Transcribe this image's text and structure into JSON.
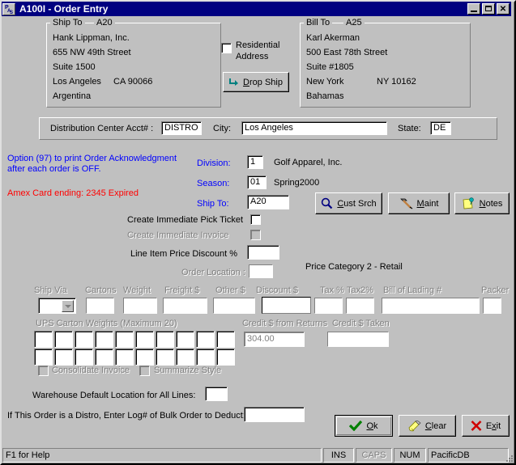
{
  "window": {
    "title": "A100I - Order Entry",
    "icon": "app-icon",
    "buttons": {
      "minimize": "minimize-icon",
      "maximize": "maximize-icon",
      "close": "close-icon"
    }
  },
  "ship_to": {
    "legend": "Ship To",
    "code": "A20",
    "lines": [
      "Hank Lippman, Inc.",
      "655 NW 49th Street",
      "Suite 1500",
      "Los Angeles          CA 90066",
      "Argentina"
    ],
    "city_state": {
      "city": "Los Angeles",
      "state_zip": "CA 90066"
    }
  },
  "bill_to": {
    "legend": "Bill To",
    "code": "A25",
    "lines": [
      "Karl Akerman",
      "500 East 78th Street",
      "Suite #1805",
      "New York             NY 10162",
      "Bahamas"
    ]
  },
  "residential": {
    "label_line1": "Residential",
    "label_line2": "Address",
    "checked": false
  },
  "drop_ship": {
    "label": "Drop Ship",
    "accesskey": "D",
    "icon": "drop-ship-arrow-icon"
  },
  "distribution": {
    "acct_label": "Distribution Center Acct# :",
    "acct_value": "DISTRO",
    "city_label": "City:",
    "city_value": "Los Angeles",
    "state_label": "State:",
    "state_value": "DE"
  },
  "messages": {
    "option_line1": "Option (97) to print Order Acknowledgment",
    "option_line2": "after each order is OFF.",
    "option_color": "#0000ff",
    "card_warning": "Amex  Card ending: 2345 Expired",
    "card_warning_color": "#ff0000"
  },
  "header_fields": {
    "division_label": "Division:",
    "division_value": "1",
    "division_name": "Golf Apparel, Inc.",
    "season_label": "Season:",
    "season_value": "01",
    "season_name": "Spring2000",
    "shipto_label": "Ship To:",
    "shipto_value": "A20"
  },
  "action_buttons": [
    {
      "name": "cust-srch-button",
      "label": "Cust Srch",
      "icon": "magnifier-icon",
      "accesskey": "C"
    },
    {
      "name": "maint-button",
      "label": "Maint",
      "icon": "hammer-icon",
      "accesskey": "M"
    },
    {
      "name": "notes-button",
      "label": "Notes",
      "icon": "notes-icon",
      "accesskey": "N"
    }
  ],
  "options": {
    "pick_ticket_label": "Create Immediate Pick Ticket",
    "pick_ticket_checked": false,
    "invoice_label": "Create Immediate Invoice",
    "invoice_checked": false,
    "invoice_disabled": true,
    "line_discount_label": "Line Item Price Discount %",
    "line_discount_value": "",
    "order_location_label": "Order Location :",
    "order_location_value": "",
    "order_location_disabled": true,
    "price_category": "Price Category 2 - Retail"
  },
  "shipping_grid": {
    "disabled": true,
    "columns": [
      {
        "header": "Ship Via",
        "value": "",
        "type": "combo"
      },
      {
        "header": "Cartons",
        "value": "",
        "type": "text"
      },
      {
        "header": "Weight",
        "value": "",
        "type": "text"
      },
      {
        "header": "Freight $",
        "value": "",
        "type": "text"
      },
      {
        "header": "Other $",
        "value": "",
        "type": "text"
      },
      {
        "header": "Discount $",
        "value": "",
        "type": "text"
      },
      {
        "header": "Tax %",
        "value": "",
        "type": "text"
      },
      {
        "header": "Tax2%",
        "value": "",
        "type": "text"
      },
      {
        "header": "Bill of Lading #",
        "value": "",
        "type": "text"
      },
      {
        "header": "Packer",
        "value": "",
        "type": "text"
      }
    ]
  },
  "carton_weights": {
    "label": "UPS Carton Weights  (Maximum 20)",
    "disabled": true,
    "count": 20,
    "values": [
      "",
      "",
      "",
      "",
      "",
      "",
      "",
      "",
      "",
      "",
      "",
      "",
      "",
      "",
      "",
      "",
      "",
      "",
      "",
      ""
    ]
  },
  "credits": {
    "returns_label": "Credit $ from Returns",
    "returns_value": "304.00",
    "taken_label": "Credit $ Taken",
    "taken_value": ""
  },
  "bottom_checks": {
    "consolidate_label": "Consolidate Invoice",
    "consolidate_checked": false,
    "summarize_label": "Summarize Style",
    "summarize_checked": false,
    "disabled": true
  },
  "warehouse": {
    "label": "Warehouse Default Location for All Lines:",
    "value": ""
  },
  "distro_order": {
    "label": "If This Order is a Distro, Enter Log# of Bulk Order to Deduct:",
    "value": ""
  },
  "dialog_buttons": [
    {
      "name": "ok-button",
      "label": "Ok",
      "icon": "green-check-icon",
      "accesskey": "O",
      "default": true
    },
    {
      "name": "clear-button",
      "label": "Clear",
      "icon": "eraser-icon",
      "accesskey": "C",
      "default": false
    },
    {
      "name": "exit-button",
      "label": "Exit",
      "icon": "red-x-icon",
      "accesskey": "x",
      "default": false
    }
  ],
  "statusbar": {
    "help": "F1 for Help",
    "ins": "INS",
    "caps": "CAPS",
    "caps_disabled": true,
    "num": "NUM",
    "db": "PacificDB"
  }
}
